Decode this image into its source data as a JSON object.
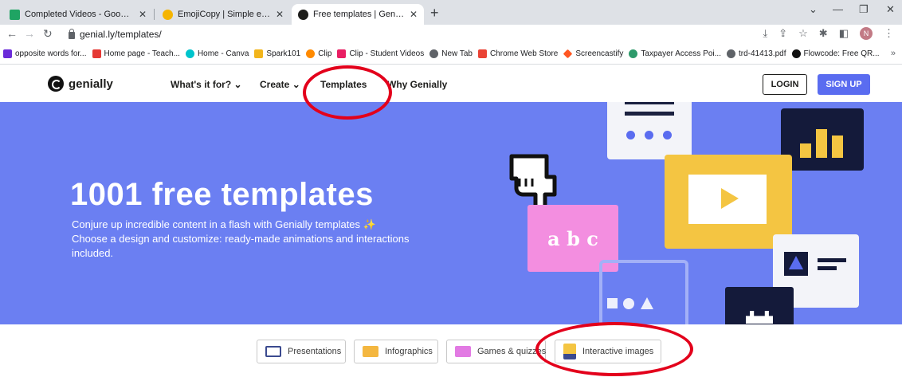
{
  "browser": {
    "tabs": [
      {
        "title": "Completed Videos - Google Drive",
        "close": "✕",
        "favicon_color": "#1fa463"
      },
      {
        "title": "EmojiCopy | Simple emoji copy and paste",
        "close": "✕",
        "favicon_color": "#f5b400"
      },
      {
        "title": "Free templates | Genially",
        "close": "✕",
        "favicon_color": "#1d1d1b"
      }
    ],
    "new_tab": "+",
    "window_controls": [
      "⌄",
      "—",
      "❐",
      "✕"
    ],
    "url": "genial.ly/templates/",
    "profile_initial": "N",
    "bookmarks": [
      {
        "label": "opposite words for...",
        "color": "#6b2bd9"
      },
      {
        "label": "Home page - Teach...",
        "color": "#e53935"
      },
      {
        "label": "Home - Canva",
        "color": "#00c4cc"
      },
      {
        "label": "Spark101",
        "color": "#f2b51c"
      },
      {
        "label": "Clip",
        "color": "#ff8a00"
      },
      {
        "label": "Clip - Student Videos",
        "color": "#e91e63"
      },
      {
        "label": "New Tab",
        "color": "#5f6368"
      },
      {
        "label": "Chrome Web Store",
        "color": "#ea4335"
      },
      {
        "label": "Screencastify",
        "color": "#ff5722"
      },
      {
        "label": "Taxpayer Access Poi...",
        "color": "#2e9a6b"
      },
      {
        "label": "trd-41413.pdf",
        "color": "#5f6368"
      },
      {
        "label": "Flowcode: Free QR...",
        "color": "#111111"
      }
    ],
    "bookmarks_more": "»"
  },
  "site": {
    "logo_text": "genially",
    "nav": [
      {
        "label": "What's it for? ⌄"
      },
      {
        "label": "Create ⌄"
      },
      {
        "label": "Templates"
      },
      {
        "label": "Why Genially"
      }
    ],
    "login": "LOGIN",
    "signup": "SIGN UP"
  },
  "hero": {
    "title": "1001 free templates",
    "line1": "Conjure up incredible content in a flash with Genially templates ✨",
    "line2": "Choose a design and customize: ready-made animations and interactions",
    "line3": "included.",
    "abc_text": "a b c"
  },
  "categories": [
    {
      "label": "Presentations",
      "icon_color": "#3b4a8f"
    },
    {
      "label": "Infographics",
      "icon_color": "#f4b740"
    },
    {
      "label": "Games & quizzes",
      "icon_color": "#e27ae3"
    },
    {
      "label": "Interactive images",
      "icon_color": "#f4c542"
    }
  ],
  "colors": {
    "hero_bg": "#6b7ff2",
    "accent": "#5a6cf0",
    "annotation": "#e3001b"
  }
}
